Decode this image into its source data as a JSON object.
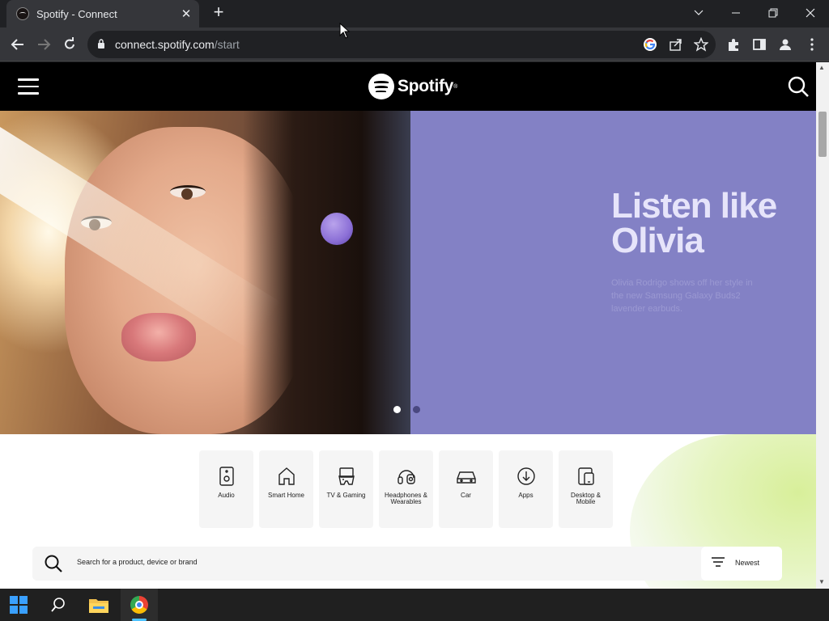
{
  "browser": {
    "tab_title": "Spotify - Connect",
    "tab_close": "✕",
    "new_tab": "+",
    "url_domain": "connect.spotify.com",
    "url_path": "/start"
  },
  "header": {
    "logo_text": "Spotify",
    "logo_mark": "®"
  },
  "hero": {
    "title": "Listen like Olivia",
    "subtitle": "Olivia Rodrigo shows off her style in the new Samsung Galaxy Buds2 lavender earbuds.",
    "slides": 2,
    "active_slide": 0
  },
  "categories": [
    {
      "label": "Audio",
      "icon": "speaker-icon"
    },
    {
      "label": "Smart Home",
      "icon": "home-icon"
    },
    {
      "label": "TV & Gaming",
      "icon": "gamepad-icon"
    },
    {
      "label": "Headphones & Wearables",
      "icon": "headphones-icon"
    },
    {
      "label": "Car",
      "icon": "car-icon"
    },
    {
      "label": "Apps",
      "icon": "download-icon"
    },
    {
      "label": "Desktop & Mobile",
      "icon": "devices-icon"
    }
  ],
  "search": {
    "placeholder": "Search for a product, device or brand",
    "sort_label": "Newest"
  },
  "colors": {
    "hero_panel": "#8381c5",
    "hero_title": "#e6e4fa",
    "header_bg": "#000000",
    "chrome_dark": "#202124"
  }
}
